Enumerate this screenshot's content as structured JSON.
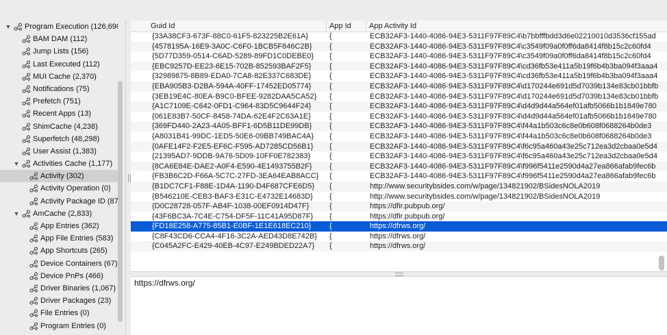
{
  "sidebar": {
    "items": [
      {
        "label": "Program Execution (126,698",
        "level": 0,
        "expanded": true,
        "icon": "category-icon"
      },
      {
        "label": "BAM DAM (112)",
        "level": 1,
        "icon": "artifact-icon"
      },
      {
        "label": "Jump Lists (156)",
        "level": 1,
        "icon": "artifact-icon"
      },
      {
        "label": "Last Executed (112)",
        "level": 1,
        "icon": "artifact-icon"
      },
      {
        "label": "MUI Cache (2,370)",
        "level": 1,
        "icon": "artifact-icon"
      },
      {
        "label": "Notifications (75)",
        "level": 1,
        "icon": "artifact-icon"
      },
      {
        "label": "Prefetch (751)",
        "level": 1,
        "icon": "artifact-icon"
      },
      {
        "label": "Recent Apps (13)",
        "level": 1,
        "icon": "artifact-icon"
      },
      {
        "label": "ShimCache (4,238)",
        "level": 1,
        "icon": "artifact-icon"
      },
      {
        "label": "Superfetch (48,298)",
        "level": 1,
        "icon": "artifact-icon"
      },
      {
        "label": "User Assist (1,383)",
        "level": 1,
        "icon": "artifact-icon"
      },
      {
        "label": "Activities Cache (1,177)",
        "level": 1,
        "expanded": true,
        "icon": "artifact-icon"
      },
      {
        "label": "Activity (302)",
        "level": 2,
        "selected": true,
        "icon": "artifact-icon"
      },
      {
        "label": "Activity Operation (0)",
        "level": 2,
        "icon": "artifact-icon"
      },
      {
        "label": "Activity Package ID (87",
        "level": 2,
        "icon": "artifact-icon"
      },
      {
        "label": "AmCache (2,833)",
        "level": 1,
        "expanded": true,
        "icon": "artifact-icon"
      },
      {
        "label": "App Entries (362)",
        "level": 2,
        "icon": "artifact-icon"
      },
      {
        "label": "App File Entries (583)",
        "level": 2,
        "icon": "artifact-icon"
      },
      {
        "label": "App Shortcuts (265)",
        "level": 2,
        "icon": "artifact-icon"
      },
      {
        "label": "Device Containers (67)",
        "level": 2,
        "icon": "artifact-icon"
      },
      {
        "label": "Device PnPs (466)",
        "level": 2,
        "icon": "artifact-icon"
      },
      {
        "label": "Driver Binaries (1,067)",
        "level": 2,
        "icon": "artifact-icon"
      },
      {
        "label": "Driver Packages (23)",
        "level": 2,
        "icon": "artifact-icon"
      },
      {
        "label": "File Entries (0)",
        "level": 2,
        "icon": "artifact-icon"
      },
      {
        "label": "Program Entries (0)",
        "level": 2,
        "icon": "artifact-icon"
      }
    ]
  },
  "table": {
    "columns": [
      "Guid Id",
      "App Id",
      "App Activity Id"
    ],
    "rows": [
      {
        "guid": "{33A38CF3-673F-88C0-61F5-823225B2E61A}",
        "app": "{",
        "activity": "ECB32AF3-1440-4086-94E3-5311F97F89C4\\b7bbfffbdd3d6e02210010d3536cf155ad"
      },
      {
        "guid": "{4578195A-16E9-3A0C-C6F0-1BCB5F846C2B}",
        "app": "{",
        "activity": "ECB32AF3-1440-4086-94E3-5311F97F89C4\\c3549f09a0f0ff6da8414f8b15c2c60fd4"
      },
      {
        "guid": "{5D77D359-0514-C6AD-5289-89FD1C0DEBE0}",
        "app": "{",
        "activity": "ECB32AF3-1440-4086-94E3-5311F97F89C4\\c3549f09a0f0ff6da8414f8b15c2c60fd4"
      },
      {
        "guid": "{EBC9257D-EE23-6E15-702B-852593BAF2F5}",
        "app": "{",
        "activity": "ECB32AF3-1440-4086-94E3-5311F97F89C4\\cd36fb53e411a5b19f6b4b3ba094f3aaa4"
      },
      {
        "guid": "{32989875-8B89-EDA0-7CA8-82E337C683DE}",
        "app": "{",
        "activity": "ECB32AF3-1440-4086-94E3-5311F97F89C4\\cd36fb53e411a5b19f6b4b3ba094f3aaa4"
      },
      {
        "guid": "{EBA905B3-D2BA-594A-40FF-17452ED05774}",
        "app": "{",
        "activity": "ECB32AF3-1440-4086-94E3-5311F97F89C4\\d170244e691d5d7039b134e83cb01bbfb"
      },
      {
        "guid": "{3EB19E4C-80EA-B9C0-BFEE-9282DAA5CA52}",
        "app": "{",
        "activity": "ECB32AF3-1440-4086-94E3-5311F97F89C4\\d170244e691d5d7039b134e83cb01bbfb"
      },
      {
        "guid": "{A1C7109E-C642-0FD1-C964-83D5C9644F24}",
        "app": "{",
        "activity": "ECB32AF3-1440-4086-94E3-5311F97F89C4\\d4d9d44a564ef01afb5066b1b1849e780"
      },
      {
        "guid": "{061E83B7-50CF-8458-74DA-62E4F2C63A1E}",
        "app": "{",
        "activity": "ECB32AF3-1440-4086-94E3-5311F97F89C4\\d4d9d44a564ef01afb5066b1b1849e780"
      },
      {
        "guid": "{369FD440-2A23-4A05-BFF1-6D5B11DE99DB}",
        "app": "{",
        "activity": "ECB32AF3-1440-4086-94E3-5311F97F89C4\\f44a1b503c6c8e0b608f0688264b0de3"
      },
      {
        "guid": "{A8031B41-99DC-1ED5-50E6-09BB749BAC4A}",
        "app": "{",
        "activity": "ECB32AF3-1440-4086-94E3-5311F97F89C4\\f44a1b503c6c8e0b608f0688264b0de3"
      },
      {
        "guid": "{0AFE14F2-F2E5-EF6C-F595-AD7285CD56B1}",
        "app": "{",
        "activity": "ECB32AF3-1440-4086-94E3-5311F97F89C4\\f6c95a460a43e25c712ea3d2cbaa0e5d4"
      },
      {
        "guid": "{21395AD7-9DDB-9A76-5D09-10FF0E782383}",
        "app": "{",
        "activity": "ECB32AF3-1440-4086-94E3-5311F97F89C4\\f6c95a460a43e25c712ea3d2cbaa0e5d4"
      },
      {
        "guid": "{8CA6E84E-DAE2-A0F4-E590-4E1493755B2F}",
        "app": "{",
        "activity": "ECB32AF3-1440-4086-94E3-5311F97F89C4\\f996f5411e2590d4a27ea866afab9fec6b"
      },
      {
        "guid": "{FB3B6C2D-F66A-5C7C-27FD-3EA64EAB8ACC}",
        "app": "{",
        "activity": "ECB32AF3-1440-4086-94E3-5311F97F89C4\\f996f5411e2590d4a27ea866afab9fec6b"
      },
      {
        "guid": "{B1DC7CF1-F88E-1D4A-1190-D4F687CFE6D5}",
        "app": "{",
        "activity": "http://www.securitybsides.com/w/page/134821902/BSidesNOLA2019"
      },
      {
        "guid": "{B546210E-CEB3-BAF3-E31C-E4732E14683D}",
        "app": "{",
        "activity": "http://www.securitybsides.com/w/page/134821902/BSidesNOLA2019"
      },
      {
        "guid": "{D0C28728-057F-AB4F-1038-00EF0914D47F}",
        "app": "{",
        "activity": "https://dfir.pubpub.org/"
      },
      {
        "guid": "{43F6BC3A-7C4E-C754-DF5F-11C41A95D87F}",
        "app": "{",
        "activity": "https://dfir.pubpub.org/"
      },
      {
        "guid": "{FD18E258-A775-85B1-E0BF-1E1E618EC210}",
        "app": "{",
        "activity": "https://dfrws.org/",
        "selected": true
      },
      {
        "guid": "{C8F43CD6-CCA4-4F16-3C2A-AED43D8E742B}",
        "app": "{",
        "activity": "https://dfrws.org/"
      },
      {
        "guid": "{C045A2FC-E429-40EB-4C97-E249BDED22A7}",
        "app": "{",
        "activity": "https://dfrws.org/"
      }
    ]
  },
  "detail": {
    "text": "https://dfrws.org/"
  },
  "colors": {
    "selection": "#0a5bd6",
    "sidebar_selection": "#d0d0d0",
    "window_bg": "#ececec"
  }
}
